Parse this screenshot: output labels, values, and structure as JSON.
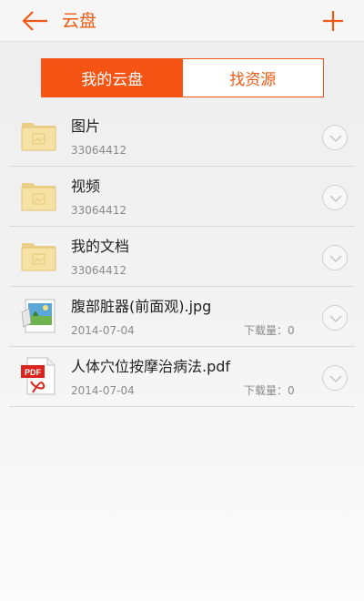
{
  "header": {
    "title": "云盘",
    "accent": "#f05a14"
  },
  "tabs": [
    {
      "label": "我的云盘",
      "active": true
    },
    {
      "label": "找资源",
      "active": false
    }
  ],
  "files": [
    {
      "name": "图片",
      "sub": "33064412",
      "type": "folder",
      "download": ""
    },
    {
      "name": "视频",
      "sub": "33064412",
      "type": "folder",
      "download": ""
    },
    {
      "name": "我的文档",
      "sub": "33064412",
      "type": "folder",
      "download": ""
    },
    {
      "name": "腹部脏器(前面观).jpg",
      "sub": "2014-07-04",
      "type": "image",
      "download": "下载量：0"
    },
    {
      "name": "人体穴位按摩治病法.pdf",
      "sub": "2014-07-04",
      "type": "pdf",
      "download": "下载量：0"
    }
  ]
}
